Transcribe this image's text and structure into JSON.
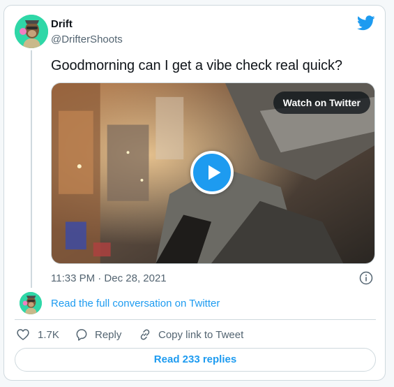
{
  "author": {
    "name": "Drift",
    "handle": "@DrifterShoots"
  },
  "tweet": {
    "text": "Goodmorning can I get a vibe check real quick?",
    "timestamp": "11:33 PM · Dec 28, 2021"
  },
  "media": {
    "watch_label": "Watch on Twitter"
  },
  "conversation": {
    "link_label": "Read the full conversation on Twitter"
  },
  "actions": {
    "like_count": "1.7K",
    "reply_label": "Reply",
    "copy_label": "Copy link to Tweet"
  },
  "replies": {
    "button_label": "Read 233 replies"
  },
  "colors": {
    "accent": "#1d9bf0",
    "text": "#0f1419",
    "secondary_text": "#536471",
    "border": "#cfd9de",
    "avatar_bg": "#2fd7a7"
  },
  "icons": {
    "brand": "twitter-bird-icon",
    "play": "play-icon",
    "info": "info-icon",
    "like": "heart-icon",
    "reply": "speech-bubble-icon",
    "copy": "link-icon"
  }
}
